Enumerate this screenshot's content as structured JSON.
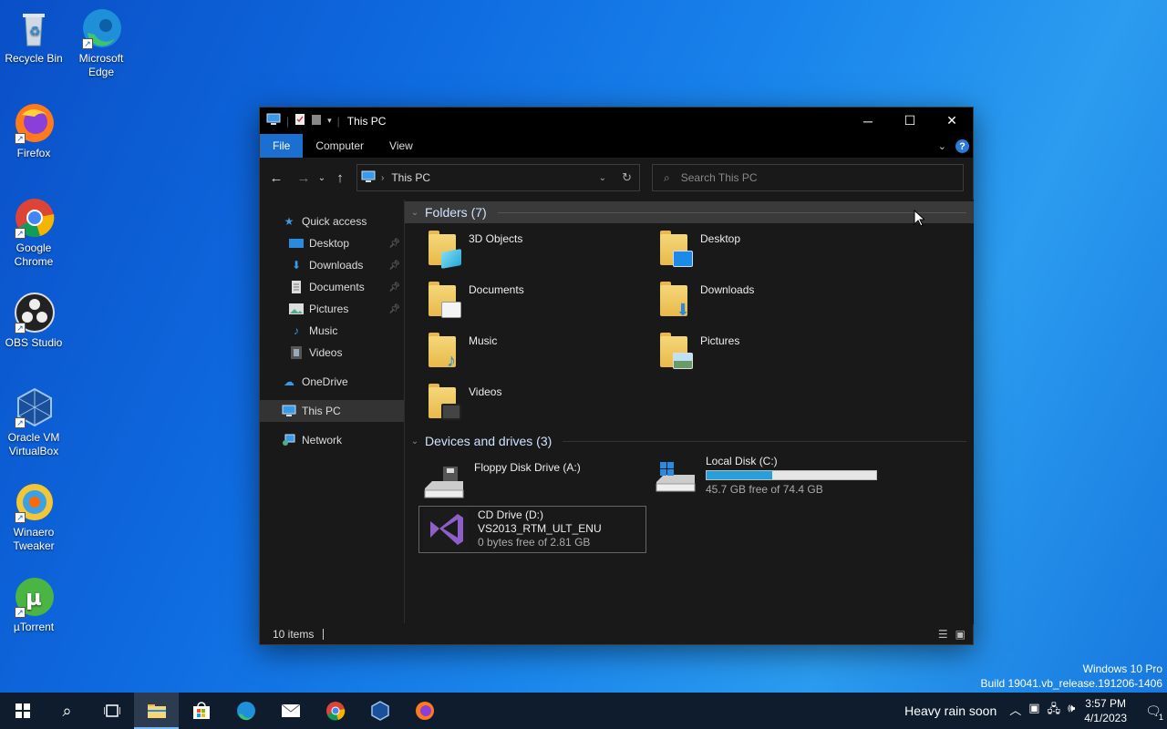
{
  "desktop": {
    "icons": [
      {
        "label": "Recycle Bin"
      },
      {
        "label": "Microsoft Edge"
      },
      {
        "label": "Firefox"
      },
      {
        "label": "Google Chrome"
      },
      {
        "label": "OBS Studio"
      },
      {
        "label": "Oracle VM VirtualBox"
      },
      {
        "label": "Winaero Tweaker"
      },
      {
        "label": "µTorrent"
      }
    ],
    "watermark_line1": "Windows 10 Pro",
    "watermark_line2": "Build 19041.vb_release.191206-1406"
  },
  "window": {
    "title": "This PC",
    "ribbon_tabs": [
      "File",
      "Computer",
      "View"
    ],
    "help_glyph": "?",
    "address": {
      "crumb": "This PC"
    },
    "search": {
      "placeholder": "Search This PC"
    },
    "nav": {
      "quick_access": "Quick access",
      "items": [
        "Desktop",
        "Downloads",
        "Documents",
        "Pictures",
        "Music",
        "Videos"
      ],
      "onedrive": "OneDrive",
      "this_pc": "This PC",
      "network": "Network"
    },
    "folders_header": "Folders (7)",
    "folders": [
      "3D Objects",
      "Desktop",
      "Documents",
      "Downloads",
      "Music",
      "Pictures",
      "Videos"
    ],
    "devices_header": "Devices and drives (3)",
    "drives": {
      "floppy": {
        "name": "Floppy Disk Drive (A:)"
      },
      "local": {
        "name": "Local Disk (C:)",
        "free": "45.7 GB free of 74.4 GB",
        "used_fraction": 0.386
      },
      "cd": {
        "name": "CD Drive (D:)",
        "label": "VS2013_RTM_ULT_ENU",
        "free": "0 bytes free of 2.81 GB"
      }
    },
    "status": {
      "items": "10 items"
    }
  },
  "taskbar": {
    "weather": "Heavy rain soon",
    "time": "3:57 PM",
    "date": "4/1/2023",
    "notification_count": "1"
  },
  "colors": {
    "accent": "#1a6fd0",
    "bar_fill": "#26a0da",
    "window_bg": "#191919"
  }
}
